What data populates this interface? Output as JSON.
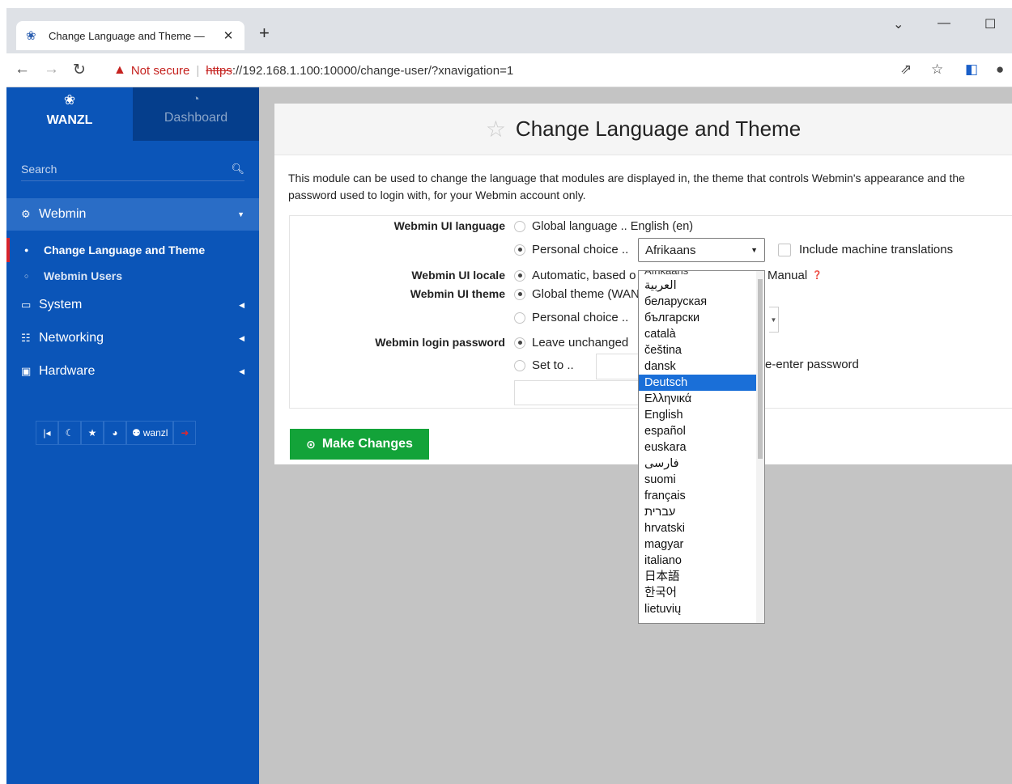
{
  "browser": {
    "tab_title": "Change Language and Theme —",
    "tab_close": "✕",
    "new_tab": "+",
    "not_secure": "Not secure",
    "separator": "|",
    "url_scheme": "https",
    "url_rest": "://192.168.1.100:10000/change-user/?xnavigation=1"
  },
  "sidebar": {
    "brand": "WANZL",
    "dashboard": "Dashboard",
    "search_placeholder": "Search",
    "menu": [
      {
        "label": "Webmin",
        "icon": "gear-icon"
      },
      {
        "label": "System",
        "icon": "monitor-icon"
      },
      {
        "label": "Networking",
        "icon": "network-icon"
      },
      {
        "label": "Hardware",
        "icon": "hardware-icon"
      }
    ],
    "submenu": [
      {
        "label": "Change Language and Theme"
      },
      {
        "label": "Webmin Users"
      }
    ],
    "user": "wanzl"
  },
  "page": {
    "title": "Change Language and Theme",
    "description": "This module can be used to change the language that modules are displayed in, the theme that controls Webmin's appearance and the password used to login with, for your Webmin account only.",
    "labels": {
      "ui_language": "Webmin UI language",
      "ui_locale": "Webmin UI locale",
      "ui_theme": "Webmin UI theme",
      "login_password": "Webmin login password"
    },
    "options": {
      "global_language": "Global language .. English (en)",
      "personal_choice": "Personal choice ..",
      "include_translations": "Include machine translations",
      "automatic": "Automatic, based o",
      "manual": "Manual",
      "global_theme": "Global theme (WAN",
      "personal_choice_theme": "Personal choice ..",
      "leave_unchanged": "Leave unchanged",
      "set_to": "Set to ..",
      "reenter": "e-enter password"
    },
    "language_select": "Afrikaans",
    "make_changes": "Make Changes"
  },
  "dropdown": {
    "peek": "Afrikaans",
    "options": [
      "العربية",
      "беларуская",
      "български",
      "català",
      "čeština",
      "dansk",
      "Deutsch",
      "Ελληνικά",
      "English",
      "español",
      "euskara",
      "فارسی",
      "suomi",
      "français",
      "עברית",
      "hrvatski",
      "magyar",
      "italiano",
      "日本語",
      "한국어",
      "lietuvių"
    ],
    "highlighted": "Deutsch"
  },
  "colors": {
    "sidebar": "#0b55b8",
    "sidebar_active": "#2a6dc6",
    "button_green": "#13a339",
    "selected_option": "#1a6fd8",
    "warning_red": "#c5221f"
  }
}
